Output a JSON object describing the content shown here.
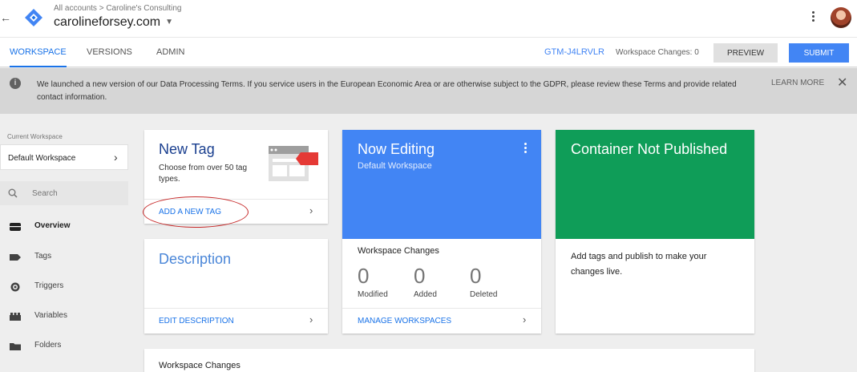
{
  "header": {
    "breadcrumb": "All accounts > Caroline's Consulting",
    "account": "carolineforsey.com"
  },
  "tabs": [
    {
      "label": "WORKSPACE",
      "active": true
    },
    {
      "label": "VERSIONS",
      "active": false
    },
    {
      "label": "ADMIN",
      "active": false
    }
  ],
  "toolbar": {
    "container_id": "GTM-J4LRVLR",
    "workspace_changes": "Workspace Changes: 0",
    "preview_label": "PREVIEW",
    "submit_label": "SUBMIT"
  },
  "notice": {
    "text": "We launched a new version of our Data Processing Terms. If you service users in the European Economic Area or are otherwise subject to the GDPR, please review these Terms and provide related contact information.",
    "learn_more": "LEARN MORE"
  },
  "sidebar": {
    "current_workspace_label": "Current Workspace",
    "workspace_name": "Default Workspace",
    "search_label": "Search",
    "items": [
      {
        "label": "Overview",
        "icon": "overview-icon"
      },
      {
        "label": "Tags",
        "icon": "tag-icon"
      },
      {
        "label": "Triggers",
        "icon": "trigger-icon"
      },
      {
        "label": "Variables",
        "icon": "variables-icon"
      },
      {
        "label": "Folders",
        "icon": "folder-icon"
      }
    ]
  },
  "cards": {
    "new_tag": {
      "title": "New Tag",
      "description": "Choose from over 50 tag types.",
      "link": "ADD A NEW TAG"
    },
    "now_editing": {
      "title": "Now Editing",
      "subtitle": "Default Workspace",
      "changes_title": "Workspace Changes",
      "stats": [
        {
          "value": "0",
          "label": "Modified"
        },
        {
          "value": "0",
          "label": "Added"
        },
        {
          "value": "0",
          "label": "Deleted"
        }
      ],
      "link": "MANAGE WORKSPACES"
    },
    "not_published": {
      "title": "Container Not Published",
      "body": "Add tags and publish to make your changes live."
    },
    "description": {
      "title": "Description",
      "link": "EDIT DESCRIPTION"
    },
    "workspace_changes": {
      "title": "Workspace Changes"
    }
  },
  "colors": {
    "accent": "#4285f4",
    "published_green": "#0f9d58",
    "annotation_red": "#c62828"
  }
}
